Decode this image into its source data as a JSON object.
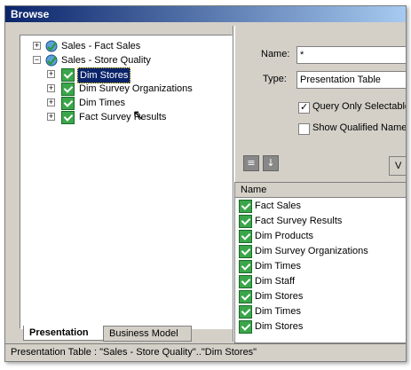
{
  "window": {
    "title": "Browse"
  },
  "tree": {
    "nodes": [
      {
        "label": "Sales - Fact Sales",
        "expander": "+",
        "icon": "cube-icon",
        "level": 0
      },
      {
        "label": "Sales - Store Quality",
        "expander": "−",
        "icon": "cube-icon",
        "level": 0
      },
      {
        "label": "Dim Stores",
        "expander": "+",
        "icon": "checked-table-icon",
        "level": 1,
        "selected": true
      },
      {
        "label": "Dim Survey Organizations",
        "expander": "+",
        "icon": "checked-table-icon",
        "level": 1
      },
      {
        "label": "Dim Times",
        "expander": "+",
        "icon": "checked-table-icon",
        "level": 1
      },
      {
        "label": "Fact Survey Results",
        "expander": "+",
        "icon": "checked-table-icon",
        "level": 1
      }
    ]
  },
  "tabs": [
    {
      "label": "Presentation",
      "active": true
    },
    {
      "label": "Business Model",
      "active": false
    }
  ],
  "right": {
    "name_label": "Name:",
    "name_value": "*",
    "type_label": "Type:",
    "type_value": "Presentation Table",
    "query_only_label": "Query Only Selectable",
    "query_only_checked": true,
    "show_qualified_label": "Show Qualified Name",
    "show_qualified_checked": false,
    "partial_button_label": "V",
    "list_header": "Name",
    "list_items": [
      "Fact Sales",
      "Fact Survey Results",
      "Dim Products",
      "Dim Survey Organizations",
      "Dim Times",
      "Dim Staff",
      "Dim Stores",
      "Dim Times",
      "Dim Stores"
    ]
  },
  "status": {
    "text": "Presentation Table : \"Sales - Store Quality\"..\"Dim Stores\""
  },
  "colors": {
    "title_bar": "#0a246a",
    "selection": "#0a246a",
    "check_icon": "#3aa64a"
  }
}
